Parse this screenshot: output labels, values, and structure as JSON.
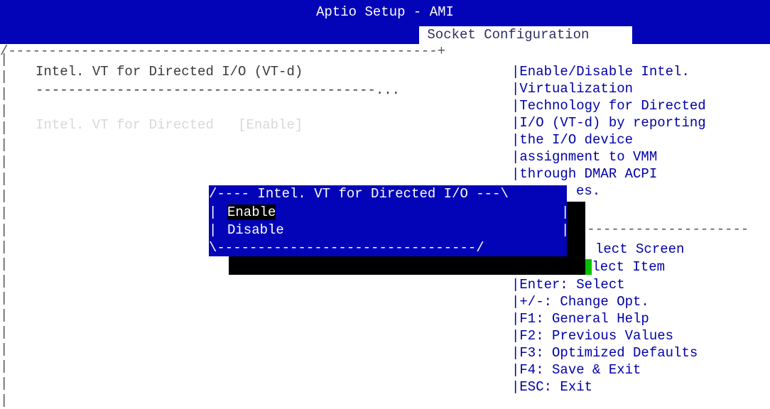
{
  "header": {
    "app_title": "Aptio Setup - AMI",
    "active_tab": "Socket Configuration"
  },
  "main": {
    "section_title": "Intel. VT for Directed I/O (VT-d)",
    "separator": "------------------------------------------...",
    "setting": {
      "label": "Intel. VT for Directed",
      "value": "[Enable]"
    }
  },
  "help": {
    "lines": [
      "Enable/Disable Intel.",
      "Virtualization",
      "Technology for Directed",
      "I/O (VT-d) by reporting",
      "the I/O device",
      "assignment to VMM",
      "through DMAR ACPI",
      "es."
    ]
  },
  "keys": {
    "lines": [
      "lect Screen",
      "lect Item",
      "Enter: Select",
      "+/-: Change Opt.",
      "F1: General Help",
      "F2: Previous Values",
      "F3: Optimized Defaults",
      "F4: Save & Exit",
      "ESC: Exit"
    ]
  },
  "popup": {
    "title": "Intel. VT for Directed I/O",
    "options": [
      "Enable",
      "Disable"
    ],
    "selected": "Enable"
  },
  "colors": {
    "title_bar": "#0303b8",
    "popup_bg": "#0303b8",
    "help_text": "#0000a8",
    "cursor": "#00c000"
  }
}
